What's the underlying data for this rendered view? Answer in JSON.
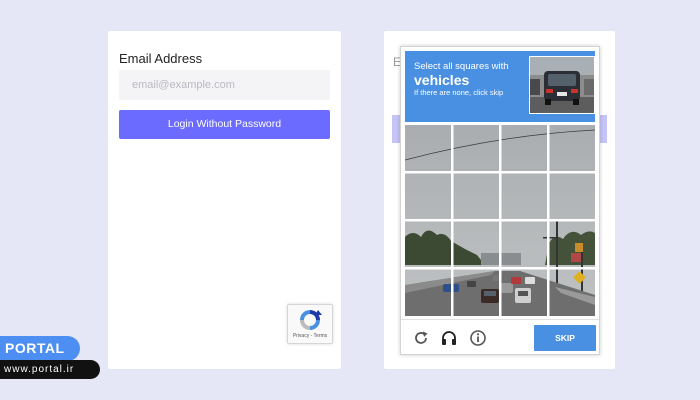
{
  "login_form": {
    "email_label": "Email Address",
    "email_placeholder": "email@example.com",
    "email_value": "",
    "login_button_label": "Login Without Password"
  },
  "recaptcha_badge": {
    "terms_text": "Privacy - Terms"
  },
  "background_form": {
    "partial_label": "E"
  },
  "captcha": {
    "instruction_line1": "Select all squares with",
    "target_word": "vehicles",
    "instruction_line2": "If there are none, click skip",
    "grid": {
      "rows": 4,
      "cols": 4,
      "selected": []
    },
    "toolbar": {
      "reload_icon": "reload-icon",
      "audio_icon": "headphones-icon",
      "info_icon": "info-icon",
      "skip_label": "SKIP"
    }
  },
  "watermark": {
    "brand": "PORTAL",
    "url": "www.portal.ir"
  },
  "colors": {
    "page_background": "#e5e7f7",
    "primary_button": "#6b6bff",
    "captcha_blue": "#4a90e2",
    "watermark_blue": "#4d8ef2"
  }
}
